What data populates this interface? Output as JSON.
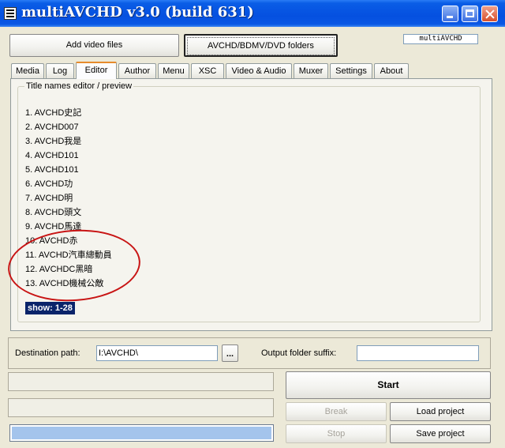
{
  "window": {
    "title": "multiAVCHD v3.0 (build 631)"
  },
  "toolbar": {
    "add_video_label": "Add video files",
    "folders_label": "AVCHD/BDMV/DVD folders",
    "logo_text": "multiAVCHD"
  },
  "tabs": [
    {
      "label": "Media"
    },
    {
      "label": "Log"
    },
    {
      "label": "Editor"
    },
    {
      "label": "Author"
    },
    {
      "label": "Menu"
    },
    {
      "label": "XSC"
    },
    {
      "label": "Video & Audio"
    },
    {
      "label": "Muxer"
    },
    {
      "label": "Settings"
    },
    {
      "label": "About"
    }
  ],
  "active_tab": "Editor",
  "editor": {
    "group_title": "Title names editor / preview",
    "titles": [
      "1. AVCHD史記",
      "2. AVCHD007",
      "3. AVCHD我是",
      "4. AVCHD101",
      "5. AVCHD101",
      "6. AVCHD功",
      "7. AVCHD明",
      "8. AVCHD頭文",
      "9. AVCHD馬達",
      "10. AVCHD赤",
      "11. AVCHD汽車總動員",
      "12. AVCHDC黑暗",
      "13. AVCHD機械公敵"
    ],
    "show_range": "show: 1-28",
    "annotation_color": "#c81414"
  },
  "destination": {
    "path_label": "Destination path:",
    "path_value": "I:\\AVCHD\\",
    "browse_label": "...",
    "suffix_label": "Output folder suffix:",
    "suffix_value": ""
  },
  "actions": {
    "start_label": "Start",
    "break_label": "Break",
    "load_label": "Load project",
    "stop_label": "Stop",
    "save_label": "Save project"
  },
  "colors": {
    "titlebar": "#0a5de6",
    "selection": "#0a246a",
    "progress_fill": "#a4c4ec"
  }
}
